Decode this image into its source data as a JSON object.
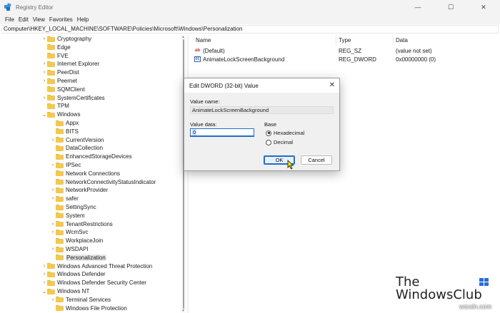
{
  "window": {
    "title": "Registry Editor",
    "controls": {
      "minimize": "—",
      "maximize": "☐",
      "close": "✕"
    }
  },
  "menu": [
    "File",
    "Edit",
    "View",
    "Favorites",
    "Help"
  ],
  "address": "Computer\\HKEY_LOCAL_MACHINE\\SOFTWARE\\Policies\\Microsoft\\Windows\\Personalization",
  "tree": {
    "items": [
      {
        "label": "Cryptography",
        "expander": ">"
      },
      {
        "label": "Edge",
        "expander": ""
      },
      {
        "label": "FVE",
        "expander": ""
      },
      {
        "label": "Internet Explorer",
        "expander": ">"
      },
      {
        "label": "PeerDist",
        "expander": ">"
      },
      {
        "label": "Peernet",
        "expander": ">"
      },
      {
        "label": "SQMClient",
        "expander": ""
      },
      {
        "label": "SystemCertificates",
        "expander": ">"
      },
      {
        "label": "TPM",
        "expander": ""
      },
      {
        "label": "Windows",
        "expander": "v"
      },
      {
        "label": "Appx",
        "expander": ""
      },
      {
        "label": "BITS",
        "expander": ""
      },
      {
        "label": "CurrentVersion",
        "expander": ">"
      },
      {
        "label": "DataCollection",
        "expander": ""
      },
      {
        "label": "EnhancedStorageDevices",
        "expander": ""
      },
      {
        "label": "IPSec",
        "expander": ">"
      },
      {
        "label": "Network Connections",
        "expander": ""
      },
      {
        "label": "NetworkConnectivityStatusIndicator",
        "expander": ""
      },
      {
        "label": "NetworkProvider",
        "expander": ">"
      },
      {
        "label": "safer",
        "expander": ">"
      },
      {
        "label": "SettingSync",
        "expander": ""
      },
      {
        "label": "System",
        "expander": ""
      },
      {
        "label": "TenantRestrictions",
        "expander": ">"
      },
      {
        "label": "WcmSvc",
        "expander": ">"
      },
      {
        "label": "WorkplaceJoin",
        "expander": ""
      },
      {
        "label": "WSDAPI",
        "expander": ">"
      },
      {
        "label": "Personalization",
        "expander": ""
      },
      {
        "label": "Windows Advanced Threat Protection",
        "expander": ">"
      },
      {
        "label": "Windows Defender",
        "expander": ">"
      },
      {
        "label": "Windows Defender Security Center",
        "expander": ">"
      },
      {
        "label": "Windows NT",
        "expander": "v"
      },
      {
        "label": "Terminal Services",
        "expander": ">"
      },
      {
        "label": "Windows File Protection",
        "expander": ""
      }
    ]
  },
  "list": {
    "columns": {
      "name": "Name",
      "type": "Type",
      "data": "Data"
    },
    "rows": [
      {
        "icon": "ab",
        "name": "(Default)",
        "type": "REG_SZ",
        "data": "(value not set)"
      },
      {
        "icon": "01",
        "name": "AnimateLockScreenBackground",
        "type": "REG_DWORD",
        "data": "0x00000000 (0)"
      }
    ]
  },
  "dialog": {
    "title": "Edit DWORD (32-bit) Value",
    "close": "✕",
    "value_name_label": "Value name:",
    "value_name": "AnimateLockScreenBackground",
    "value_data_label": "Value data:",
    "value_data": "0",
    "base_label": "Base",
    "hex_label": "Hexadecimal",
    "dec_label": "Decimal",
    "ok": "OK",
    "cancel": "Cancel"
  },
  "watermark": {
    "line1": "The",
    "line2": "WindowsClub",
    "site": "wsxdn.com"
  }
}
